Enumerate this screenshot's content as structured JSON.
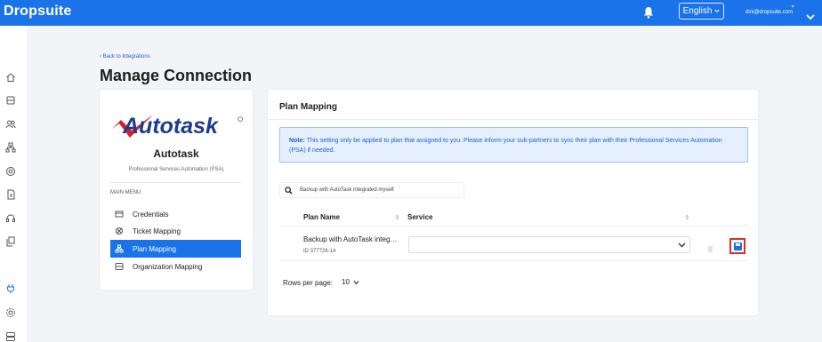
{
  "header": {
    "logo_text": "Dropsuite",
    "language": "English",
    "user_email": "dini@dropsuite.com"
  },
  "sidebar": {
    "icons": [
      "home-icon",
      "backup-icon",
      "users-icon",
      "org-chart-icon",
      "settings-ring-icon",
      "report-icon",
      "support-icon",
      "copy-icon",
      "integrations-icon",
      "gear-icon",
      "servers-icon"
    ]
  },
  "breadcrumb": {
    "back_label": "‹ Back to Integrations"
  },
  "page": {
    "title": "Manage Connection"
  },
  "integration": {
    "logo_text": "Autotask",
    "name": "Autotask",
    "subtitle": "Professional Services Automation (PSA)",
    "menu_title": "MAIN MENU",
    "menu": [
      {
        "label": "Credentials",
        "icon": "credentials-icon",
        "active": false
      },
      {
        "label": "Ticket Mapping",
        "icon": "ticket-icon",
        "active": false
      },
      {
        "label": "Plan Mapping",
        "icon": "plan-icon",
        "active": true
      },
      {
        "label": "Organization Mapping",
        "icon": "organization-icon",
        "active": false
      }
    ]
  },
  "plan_mapping": {
    "title": "Plan Mapping",
    "note_label": "Note:",
    "note_text": " This setting only be applied to plan that assigned to you. Please inform your sub-partners to sync their plan with their Professional Services Automation (PSA) if needed.",
    "search_value": "Backup with AutoTask integrated myself",
    "columns": [
      "Plan Name",
      "Service"
    ],
    "rows": [
      {
        "plan_name": "Backup with AutoTask integ…",
        "plan_id": "ID 377726-14",
        "service": ""
      }
    ],
    "rows_per_page_label": "Rows per page:",
    "rows_per_page_value": "10"
  },
  "colors": {
    "primary": "#1a73e8",
    "highlight_border": "#e02a2a",
    "note_bg": "#e6f0fd"
  }
}
